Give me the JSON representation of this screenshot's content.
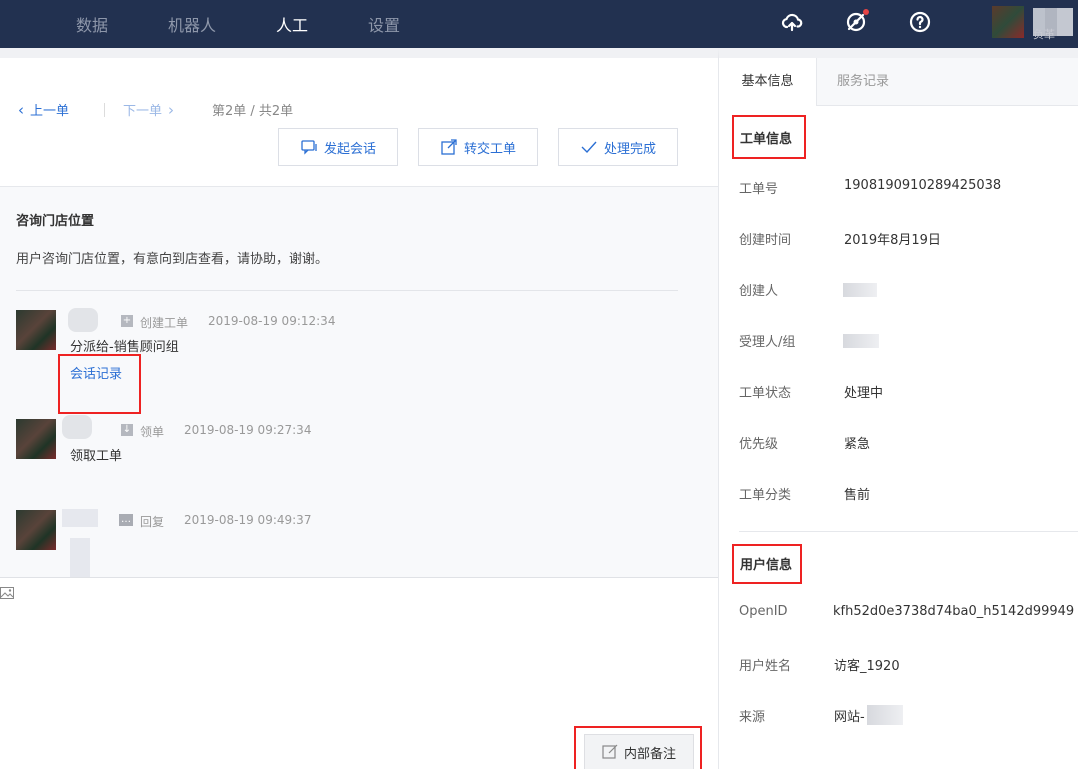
{
  "nav": {
    "items": [
      "数据",
      "机器人",
      "人工",
      "设置"
    ],
    "active_index": 2
  },
  "user": {
    "role_label": "负革"
  },
  "pager": {
    "prev_label": "上一单",
    "next_label": "下一单",
    "count": "第2单 / 共2单"
  },
  "actions": {
    "start_chat": "发起会话",
    "transfer": "转交工单",
    "complete": "处理完成"
  },
  "ticket": {
    "title": "咨询门店位置",
    "description": "用户咨询门店位置，有意向到店查看，请协助，谢谢。"
  },
  "logs": [
    {
      "type": "创建工单",
      "time": "2019-08-19 09:12:34",
      "text": "分派给-销售顾问组",
      "link": "会话记录"
    },
    {
      "type": "领单",
      "time": "2019-08-19 09:27:34",
      "text": "领取工单"
    },
    {
      "type": "回复",
      "time": "2019-08-19 09:49:37"
    }
  ],
  "internal_note": "内部备注",
  "tabs": [
    "基本信息",
    "服务记录"
  ],
  "ticket_info": {
    "section_title": "工单信息",
    "fields": [
      {
        "label": "工单号",
        "value": "1908190910289425038"
      },
      {
        "label": "创建时间",
        "value": "2019年8月19日"
      },
      {
        "label": "创建人",
        "value": ""
      },
      {
        "label": "受理人/组",
        "value": ""
      },
      {
        "label": "工单状态",
        "value": "处理中"
      },
      {
        "label": "优先级",
        "value": "紧急"
      },
      {
        "label": "工单分类",
        "value": "售前"
      }
    ]
  },
  "user_info": {
    "section_title": "用户信息",
    "fields": [
      {
        "label": "OpenID",
        "value": "kfh52d0e3738d74ba0_h5142d99949"
      },
      {
        "label": "用户姓名",
        "value": "访客_1920"
      },
      {
        "label": "来源",
        "value": "网站-"
      }
    ]
  },
  "colors": {
    "nav_bg": "#223150",
    "link": "#2b6fd4",
    "highlight": "#e22222"
  }
}
